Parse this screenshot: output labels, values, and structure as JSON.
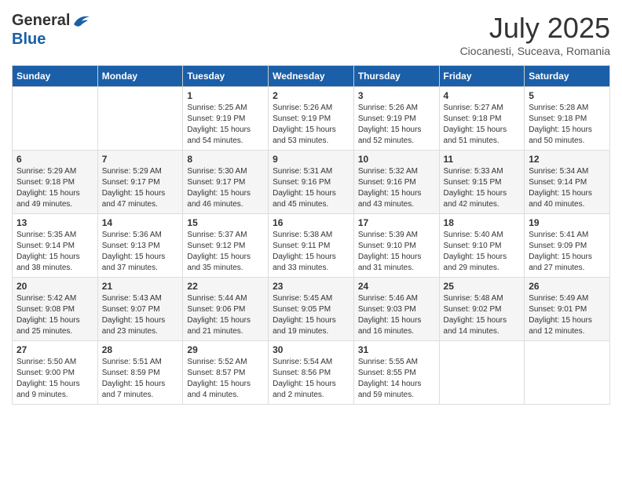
{
  "header": {
    "logo_line1": "General",
    "logo_line2": "Blue",
    "month_year": "July 2025",
    "location": "Ciocanesti, Suceava, Romania"
  },
  "weekdays": [
    "Sunday",
    "Monday",
    "Tuesday",
    "Wednesday",
    "Thursday",
    "Friday",
    "Saturday"
  ],
  "weeks": [
    [
      {
        "day": "",
        "info": ""
      },
      {
        "day": "",
        "info": ""
      },
      {
        "day": "1",
        "info": "Sunrise: 5:25 AM\nSunset: 9:19 PM\nDaylight: 15 hours\nand 54 minutes."
      },
      {
        "day": "2",
        "info": "Sunrise: 5:26 AM\nSunset: 9:19 PM\nDaylight: 15 hours\nand 53 minutes."
      },
      {
        "day": "3",
        "info": "Sunrise: 5:26 AM\nSunset: 9:19 PM\nDaylight: 15 hours\nand 52 minutes."
      },
      {
        "day": "4",
        "info": "Sunrise: 5:27 AM\nSunset: 9:18 PM\nDaylight: 15 hours\nand 51 minutes."
      },
      {
        "day": "5",
        "info": "Sunrise: 5:28 AM\nSunset: 9:18 PM\nDaylight: 15 hours\nand 50 minutes."
      }
    ],
    [
      {
        "day": "6",
        "info": "Sunrise: 5:29 AM\nSunset: 9:18 PM\nDaylight: 15 hours\nand 49 minutes."
      },
      {
        "day": "7",
        "info": "Sunrise: 5:29 AM\nSunset: 9:17 PM\nDaylight: 15 hours\nand 47 minutes."
      },
      {
        "day": "8",
        "info": "Sunrise: 5:30 AM\nSunset: 9:17 PM\nDaylight: 15 hours\nand 46 minutes."
      },
      {
        "day": "9",
        "info": "Sunrise: 5:31 AM\nSunset: 9:16 PM\nDaylight: 15 hours\nand 45 minutes."
      },
      {
        "day": "10",
        "info": "Sunrise: 5:32 AM\nSunset: 9:16 PM\nDaylight: 15 hours\nand 43 minutes."
      },
      {
        "day": "11",
        "info": "Sunrise: 5:33 AM\nSunset: 9:15 PM\nDaylight: 15 hours\nand 42 minutes."
      },
      {
        "day": "12",
        "info": "Sunrise: 5:34 AM\nSunset: 9:14 PM\nDaylight: 15 hours\nand 40 minutes."
      }
    ],
    [
      {
        "day": "13",
        "info": "Sunrise: 5:35 AM\nSunset: 9:14 PM\nDaylight: 15 hours\nand 38 minutes."
      },
      {
        "day": "14",
        "info": "Sunrise: 5:36 AM\nSunset: 9:13 PM\nDaylight: 15 hours\nand 37 minutes."
      },
      {
        "day": "15",
        "info": "Sunrise: 5:37 AM\nSunset: 9:12 PM\nDaylight: 15 hours\nand 35 minutes."
      },
      {
        "day": "16",
        "info": "Sunrise: 5:38 AM\nSunset: 9:11 PM\nDaylight: 15 hours\nand 33 minutes."
      },
      {
        "day": "17",
        "info": "Sunrise: 5:39 AM\nSunset: 9:10 PM\nDaylight: 15 hours\nand 31 minutes."
      },
      {
        "day": "18",
        "info": "Sunrise: 5:40 AM\nSunset: 9:10 PM\nDaylight: 15 hours\nand 29 minutes."
      },
      {
        "day": "19",
        "info": "Sunrise: 5:41 AM\nSunset: 9:09 PM\nDaylight: 15 hours\nand 27 minutes."
      }
    ],
    [
      {
        "day": "20",
        "info": "Sunrise: 5:42 AM\nSunset: 9:08 PM\nDaylight: 15 hours\nand 25 minutes."
      },
      {
        "day": "21",
        "info": "Sunrise: 5:43 AM\nSunset: 9:07 PM\nDaylight: 15 hours\nand 23 minutes."
      },
      {
        "day": "22",
        "info": "Sunrise: 5:44 AM\nSunset: 9:06 PM\nDaylight: 15 hours\nand 21 minutes."
      },
      {
        "day": "23",
        "info": "Sunrise: 5:45 AM\nSunset: 9:05 PM\nDaylight: 15 hours\nand 19 minutes."
      },
      {
        "day": "24",
        "info": "Sunrise: 5:46 AM\nSunset: 9:03 PM\nDaylight: 15 hours\nand 16 minutes."
      },
      {
        "day": "25",
        "info": "Sunrise: 5:48 AM\nSunset: 9:02 PM\nDaylight: 15 hours\nand 14 minutes."
      },
      {
        "day": "26",
        "info": "Sunrise: 5:49 AM\nSunset: 9:01 PM\nDaylight: 15 hours\nand 12 minutes."
      }
    ],
    [
      {
        "day": "27",
        "info": "Sunrise: 5:50 AM\nSunset: 9:00 PM\nDaylight: 15 hours\nand 9 minutes."
      },
      {
        "day": "28",
        "info": "Sunrise: 5:51 AM\nSunset: 8:59 PM\nDaylight: 15 hours\nand 7 minutes."
      },
      {
        "day": "29",
        "info": "Sunrise: 5:52 AM\nSunset: 8:57 PM\nDaylight: 15 hours\nand 4 minutes."
      },
      {
        "day": "30",
        "info": "Sunrise: 5:54 AM\nSunset: 8:56 PM\nDaylight: 15 hours\nand 2 minutes."
      },
      {
        "day": "31",
        "info": "Sunrise: 5:55 AM\nSunset: 8:55 PM\nDaylight: 14 hours\nand 59 minutes."
      },
      {
        "day": "",
        "info": ""
      },
      {
        "day": "",
        "info": ""
      }
    ]
  ]
}
